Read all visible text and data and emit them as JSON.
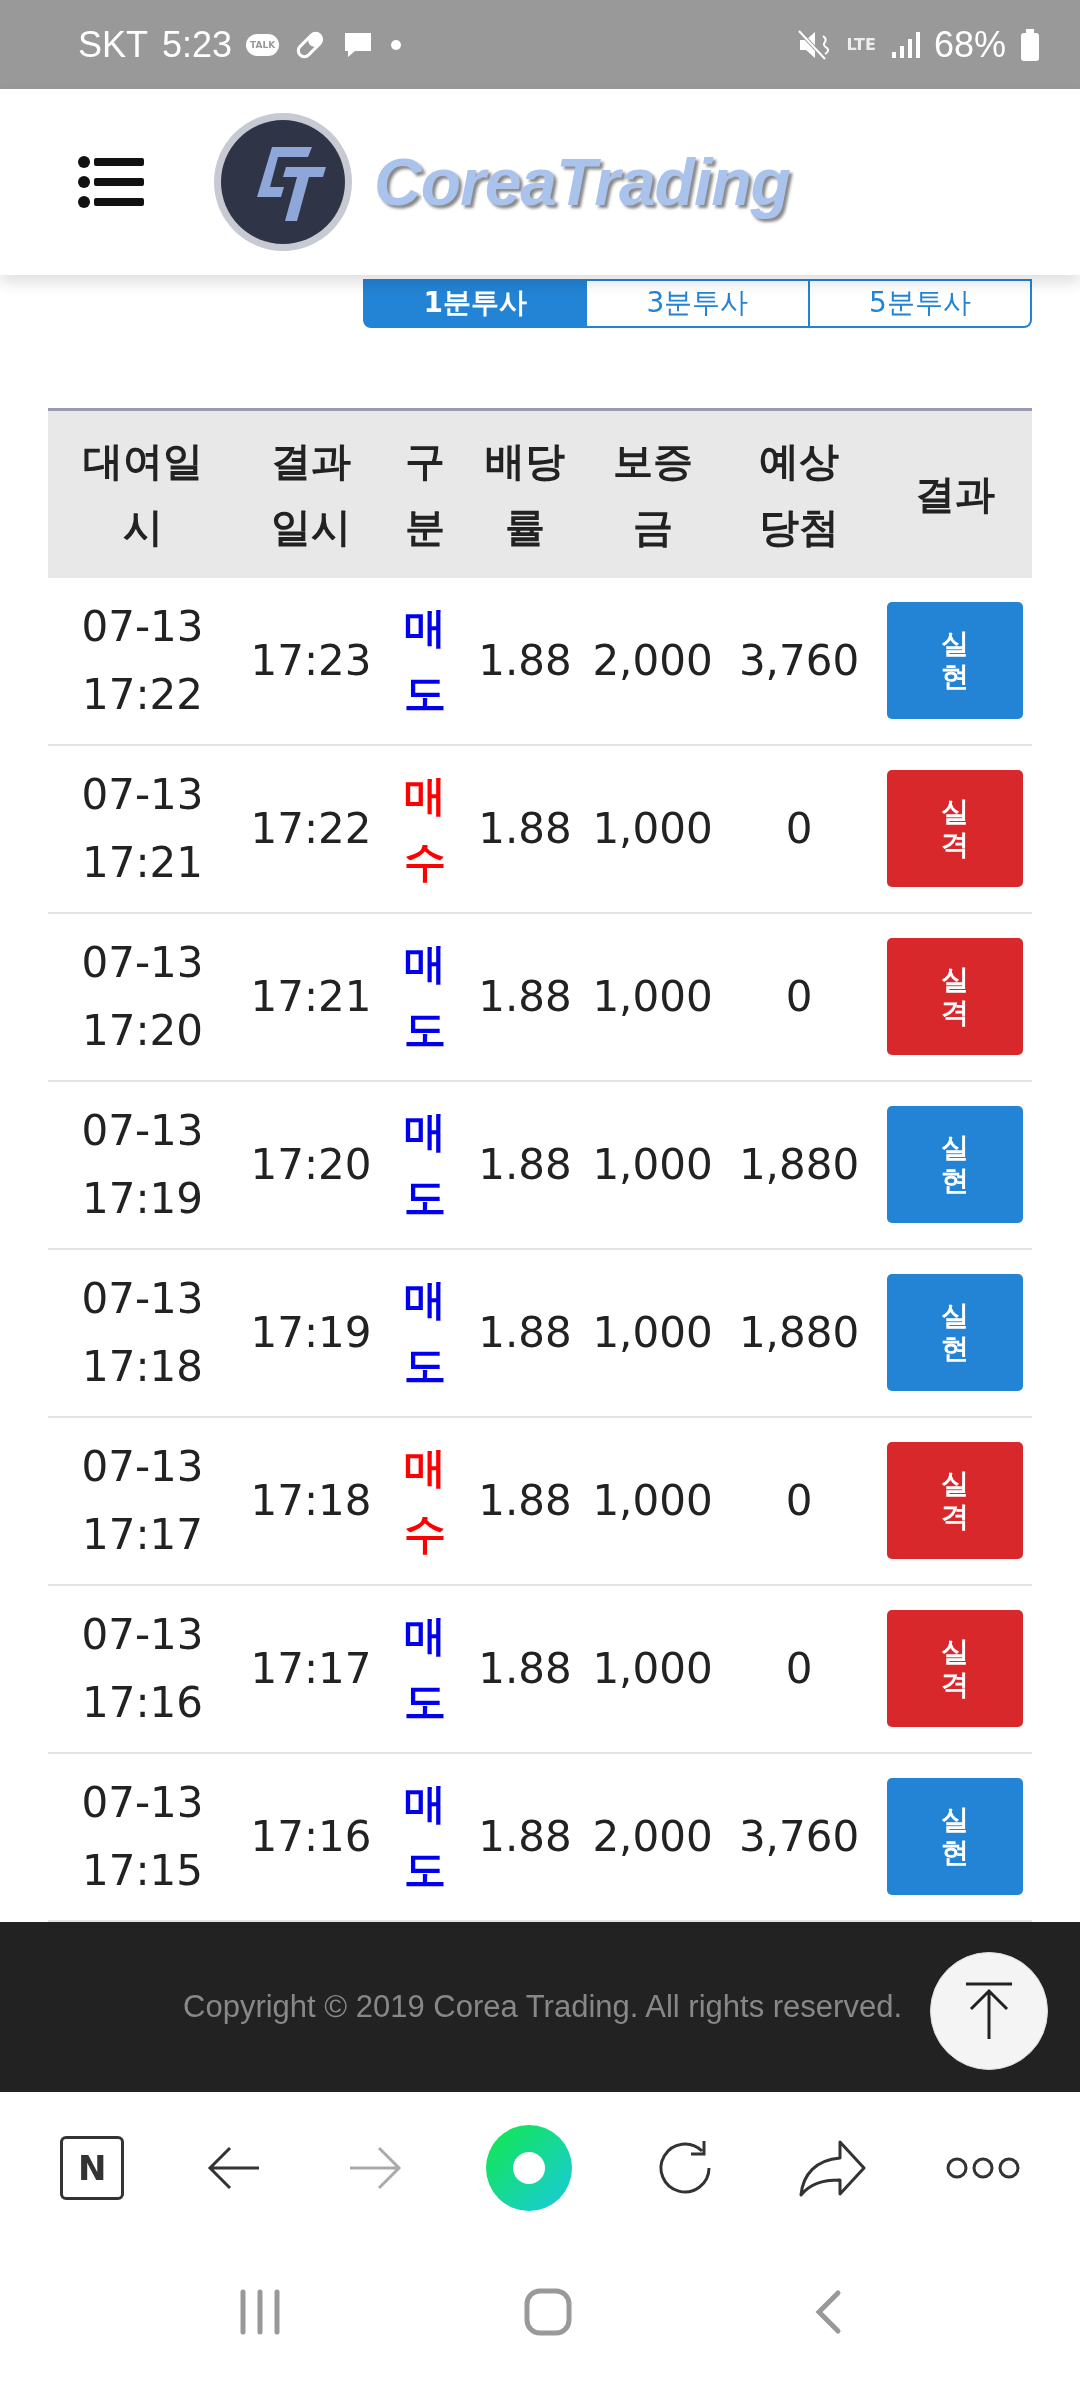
{
  "status_bar": {
    "carrier": "SKT",
    "time": "5:23",
    "talk_label": "TALK",
    "network": "LTE",
    "battery": "68%"
  },
  "header": {
    "logo_text": "CoreaTrading"
  },
  "tabs": [
    {
      "label": "1분투사",
      "selected": true
    },
    {
      "label": "3분투사",
      "selected": false
    },
    {
      "label": "5분투사",
      "selected": false
    }
  ],
  "table": {
    "columns": [
      "대여일시",
      "결과일시",
      "구분",
      "배당률",
      "보증금",
      "예상당첨",
      "결과"
    ],
    "rows": [
      {
        "date": "07-13",
        "time": "17:22",
        "result_time": "17:23",
        "side": {
          "label": "매도",
          "kind": "sell"
        },
        "odds": "1.88",
        "deposit": "2,000",
        "expected": "3,760",
        "result": {
          "label": "실현",
          "kind": "win"
        }
      },
      {
        "date": "07-13",
        "time": "17:21",
        "result_time": "17:22",
        "side": {
          "label": "매수",
          "kind": "buy"
        },
        "odds": "1.88",
        "deposit": "1,000",
        "expected": "0",
        "result": {
          "label": "실격",
          "kind": "lose"
        }
      },
      {
        "date": "07-13",
        "time": "17:20",
        "result_time": "17:21",
        "side": {
          "label": "매도",
          "kind": "sell"
        },
        "odds": "1.88",
        "deposit": "1,000",
        "expected": "0",
        "result": {
          "label": "실격",
          "kind": "lose"
        }
      },
      {
        "date": "07-13",
        "time": "17:19",
        "result_time": "17:20",
        "side": {
          "label": "매도",
          "kind": "sell"
        },
        "odds": "1.88",
        "deposit": "1,000",
        "expected": "1,880",
        "result": {
          "label": "실현",
          "kind": "win"
        }
      },
      {
        "date": "07-13",
        "time": "17:18",
        "result_time": "17:19",
        "side": {
          "label": "매도",
          "kind": "sell"
        },
        "odds": "1.88",
        "deposit": "1,000",
        "expected": "1,880",
        "result": {
          "label": "실현",
          "kind": "win"
        }
      },
      {
        "date": "07-13",
        "time": "17:17",
        "result_time": "17:18",
        "side": {
          "label": "매수",
          "kind": "buy"
        },
        "odds": "1.88",
        "deposit": "1,000",
        "expected": "0",
        "result": {
          "label": "실격",
          "kind": "lose"
        }
      },
      {
        "date": "07-13",
        "time": "17:16",
        "result_time": "17:17",
        "side": {
          "label": "매도",
          "kind": "sell"
        },
        "odds": "1.88",
        "deposit": "1,000",
        "expected": "0",
        "result": {
          "label": "실격",
          "kind": "lose"
        }
      },
      {
        "date": "07-13",
        "time": "17:15",
        "result_time": "17:16",
        "side": {
          "label": "매도",
          "kind": "sell"
        },
        "odds": "1.88",
        "deposit": "2,000",
        "expected": "3,760",
        "result": {
          "label": "실현",
          "kind": "win"
        }
      }
    ]
  },
  "footer": {
    "copyright": "Copyright © 2019 Corea Trading. All rights reserved."
  },
  "browser_toolbar": {
    "home_label": "N"
  }
}
